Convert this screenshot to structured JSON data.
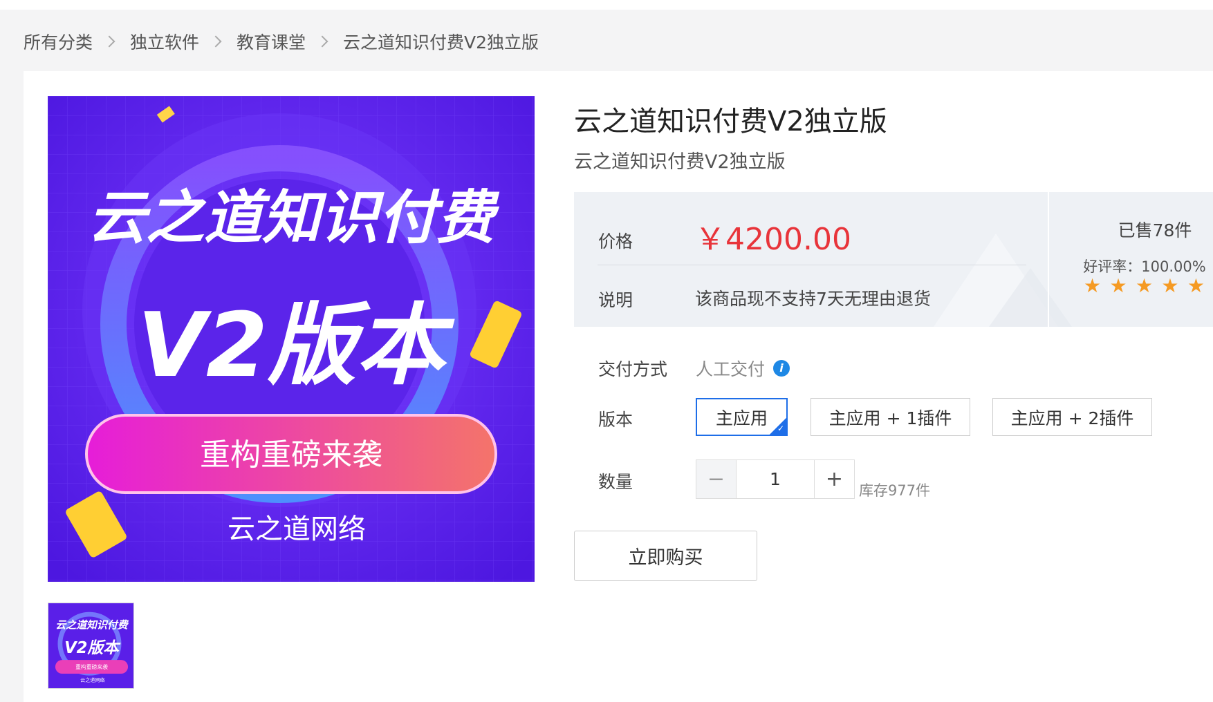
{
  "breadcrumb": [
    "所有分类",
    "独立软件",
    "教育课堂",
    "云之道知识付费V2独立版"
  ],
  "product": {
    "title": "云之道知识付费V2独立版",
    "subtitle": "云之道知识付费V2独立版"
  },
  "banner": {
    "line1": "云之道知识付费",
    "line2": "V2版本",
    "pill": "重构重磅来袭",
    "footer": "云之道网络",
    "colors": {
      "background": "#5a1fe8",
      "pill_start": "#e61dd9",
      "pill_end": "#f4746a"
    }
  },
  "price_box": {
    "price_label": "价格",
    "price": "￥4200.00",
    "note_label": "说明",
    "note": "该商品现不支持7天无理由退货",
    "sold": "已售78件",
    "rating": "好评率：100.00%",
    "stars": 5
  },
  "delivery": {
    "label": "交付方式",
    "value": "人工交付",
    "icon": "info-icon"
  },
  "version": {
    "label": "版本",
    "options": [
      "主应用",
      "主应用 + 1插件",
      "主应用 + 2插件"
    ],
    "selected": 0
  },
  "quantity": {
    "label": "数量",
    "value": "1",
    "minus": "−",
    "plus": "+",
    "stock": "库存977件"
  },
  "buy_button": "立即购买",
  "colors": {
    "price": "#e8343a",
    "accent": "#1e6ee8",
    "star": "#f59a23"
  }
}
